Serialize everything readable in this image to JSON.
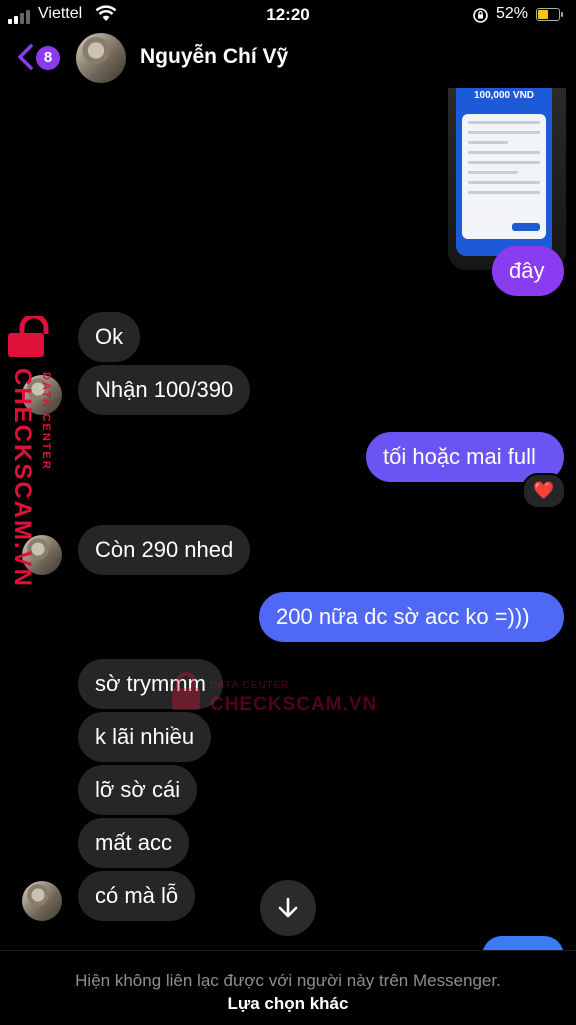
{
  "status_bar": {
    "carrier": "Viettel",
    "time": "12:20",
    "battery": "52%"
  },
  "header": {
    "unread_count": "8",
    "contact_name": "Nguyễn Chí Vỹ"
  },
  "image_attachment": {
    "amount_text": "100,000 VND"
  },
  "messages": [
    {
      "side": "out",
      "text": "đây"
    },
    {
      "side": "in",
      "text": "Ok"
    },
    {
      "side": "in",
      "text": "Nhận 100/390"
    },
    {
      "side": "out",
      "text": "tối hoặc mai full",
      "reaction": "❤️"
    },
    {
      "side": "in",
      "text": "Còn 290 nhed"
    },
    {
      "side": "out",
      "text": "200 nữa dc sờ acc ko =)))"
    },
    {
      "side": "in",
      "text": "sờ trymmm"
    },
    {
      "side": "in",
      "text": "k lãi nhiều"
    },
    {
      "side": "in",
      "text": "lỡ sờ cái"
    },
    {
      "side": "in",
      "text": "mất acc"
    },
    {
      "side": "in",
      "text": "có mà lỗ"
    }
  ],
  "watermark": {
    "brand": "CHECKSCAM.VN",
    "sub": "DATA CENTER"
  },
  "footer": {
    "notice": "Hiện không liên lạc được với người này trên Messenger.",
    "other_option": "Lựa chọn khác"
  },
  "colors": {
    "background": "#000000",
    "incoming_bubble": "#262626",
    "outgoing_gradient": [
      "#8a3cf0",
      "#3a7cf5"
    ],
    "badge": "#8c3cf0"
  },
  "icons": {
    "back": "chevron-left-icon",
    "scroll": "arrow-down-icon",
    "wifi": "wifi-icon",
    "lock": "orientation-lock-icon"
  }
}
